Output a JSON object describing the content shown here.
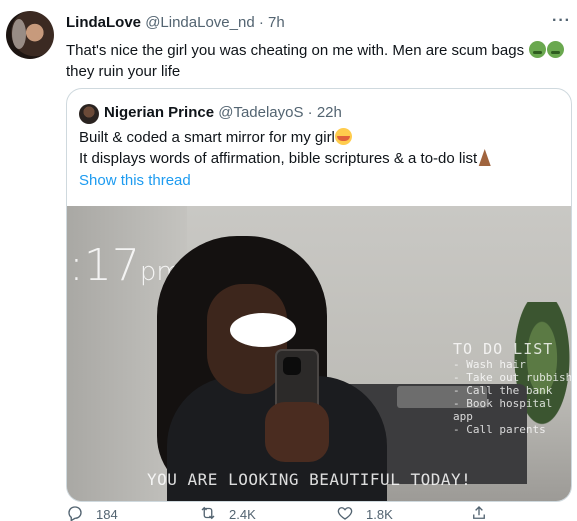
{
  "tweet": {
    "author_name": "LindaLove",
    "author_handle": "@LindaLove_nd",
    "separator": "·",
    "time": "7h",
    "more": "···",
    "text_line1": "That's nice the girl you was cheating on me with. Men are scum bags",
    "text_line2": "they ruin your life"
  },
  "quote": {
    "author_name": "Nigerian Prince",
    "author_handle": "@TadelayoS",
    "separator": "·",
    "time": "22h",
    "text_line1": "Built & coded a smart mirror for my girl",
    "text_line2": "It displays words of affirmation, bible scriptures & a to-do list",
    "show_thread": "Show this thread",
    "media": {
      "clock": ":17",
      "clock_suffix": "pm",
      "todo_title": "TO DO LIST",
      "todo_items": [
        "- Wash hair",
        "- Take out rubbish",
        "- Call the bank",
        "- Book hospital app",
        "- Call parents"
      ],
      "affirmation": "YOU ARE LOOKING BEAUTIFUL TODAY!"
    }
  },
  "actions": {
    "reply_count": "184",
    "retweet_count": "2.4K",
    "like_count": "1.8K"
  },
  "icons": [
    "reply-icon",
    "retweet-icon",
    "like-icon",
    "share-icon",
    "more-icon"
  ]
}
